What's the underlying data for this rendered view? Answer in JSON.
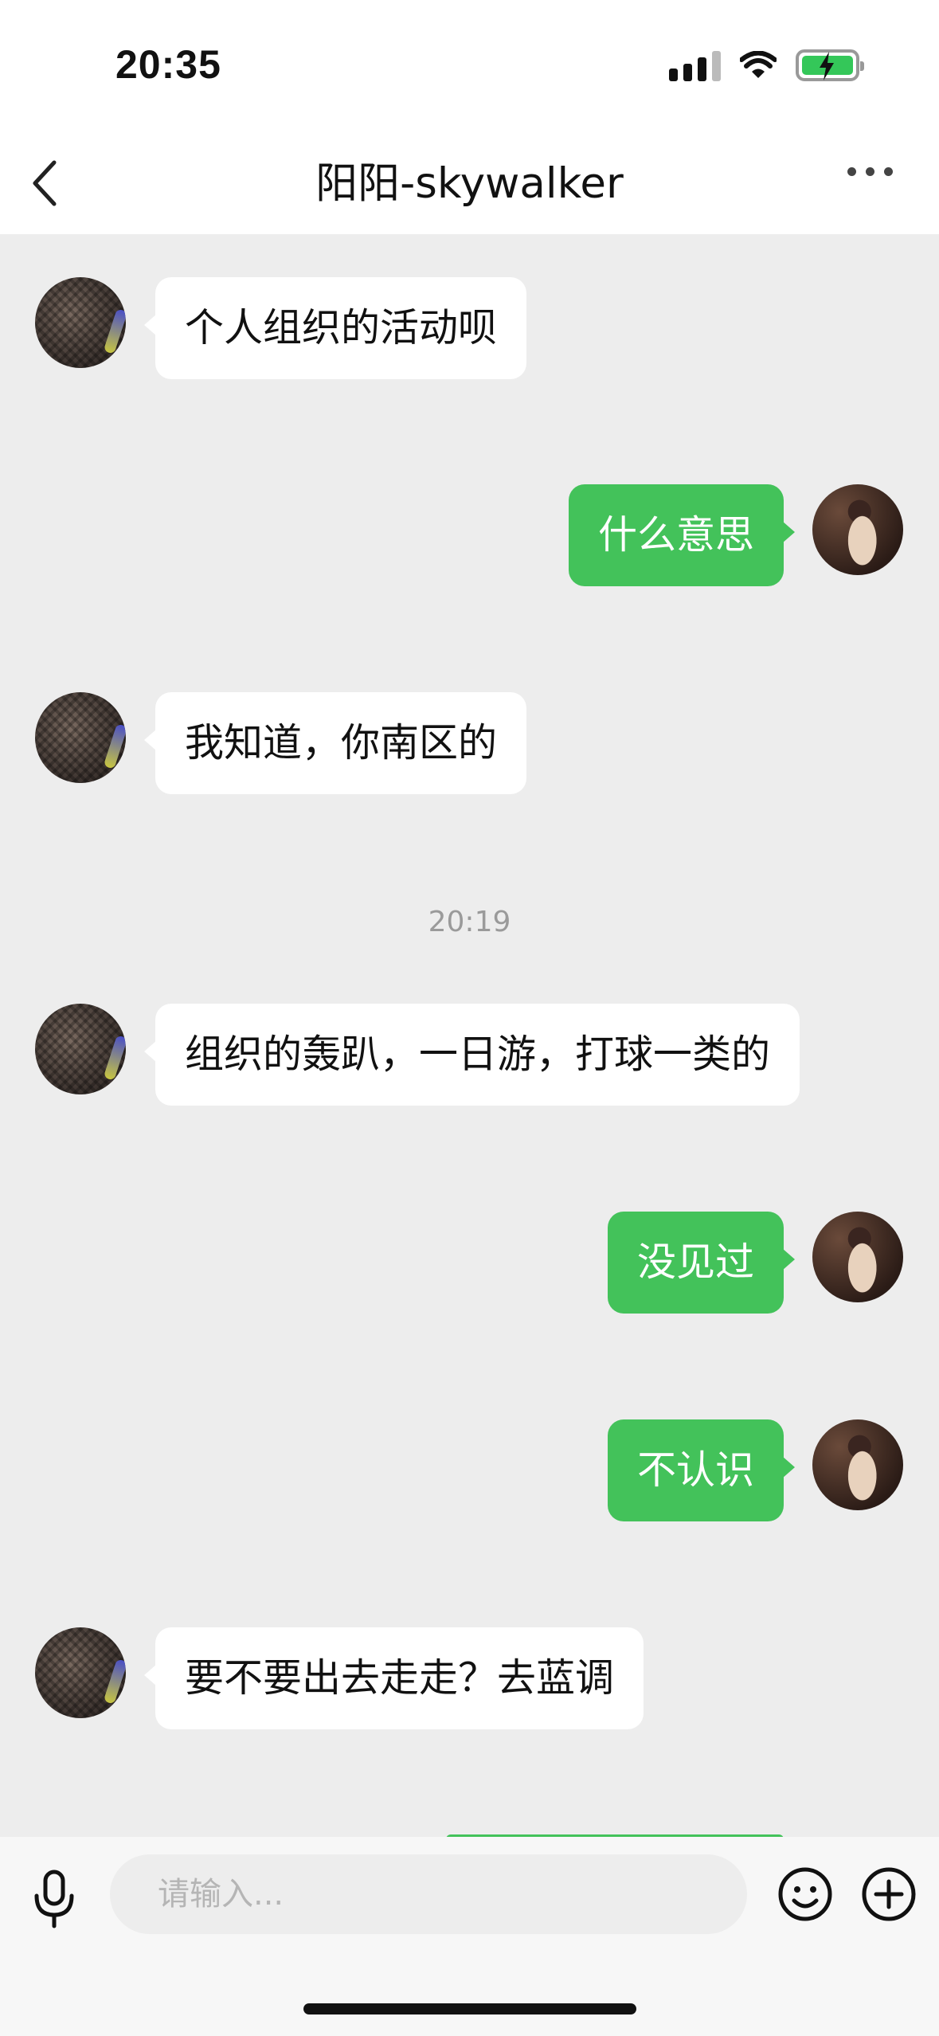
{
  "status_bar": {
    "time": "20:35"
  },
  "nav": {
    "title": "阳阳-skywalker"
  },
  "messages": [
    {
      "from": "them",
      "text": "个人组织的活动呗"
    },
    {
      "from": "me",
      "text": "什么意思"
    },
    {
      "from": "them",
      "text": "我知道，你南区的"
    },
    {
      "from": "them",
      "text": "组织的轰趴，一日游，打球一类的"
    },
    {
      "from": "me",
      "text": "没见过"
    },
    {
      "from": "me",
      "text": "不认识"
    },
    {
      "from": "them",
      "text": "要不要出去走走？去蓝调"
    }
  ],
  "timestamp": "20:19",
  "input": {
    "placeholder": "请输入..."
  },
  "colors": {
    "my_bubble": "#43c25a",
    "their_bubble": "#ffffff",
    "chat_background": "#ededed",
    "battery_fill": "#34c759"
  },
  "icons": {
    "back": "chevron-left-icon",
    "more": "ellipsis-icon",
    "mic": "microphone-icon",
    "emoji": "smiley-icon",
    "plus": "plus-circle-icon"
  }
}
